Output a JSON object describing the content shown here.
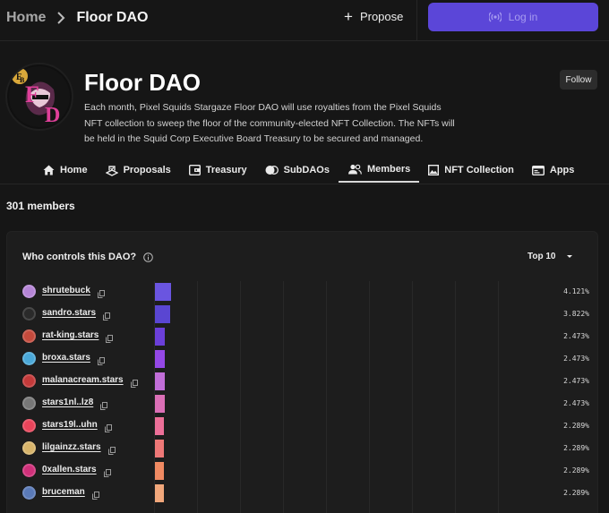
{
  "breadcrumb": {
    "home": "Home",
    "current": "Floor DAO"
  },
  "header_actions": {
    "propose": "Propose",
    "login": "Log in"
  },
  "dao": {
    "title": "Floor DAO",
    "description": "Each month, Pixel Squids Stargaze Floor DAO will use royalties from the Pixel Squids NFT collection to sweep the floor of the community-elected NFT Collection. The NFTs will be held in the Squid Corp Executive Board Treasury to be secured and managed.",
    "follow": "Follow",
    "logo_letters": {
      "a": "F",
      "b": "B",
      "c": "E",
      "d": "D"
    }
  },
  "tabs": [
    {
      "label": "Home",
      "icon": "home-icon"
    },
    {
      "label": "Proposals",
      "icon": "proposals-icon"
    },
    {
      "label": "Treasury",
      "icon": "treasury-icon"
    },
    {
      "label": "SubDAOs",
      "icon": "subdaos-icon"
    },
    {
      "label": "Members",
      "icon": "members-icon",
      "active": true
    },
    {
      "label": "NFT Collection",
      "icon": "image-icon"
    },
    {
      "label": "Apps",
      "icon": "apps-icon"
    }
  ],
  "members_count": "301 members",
  "card": {
    "title": "Who controls this DAO?",
    "filter": "Top 10"
  },
  "members": [
    {
      "name": "shrutebuck",
      "pct": "4.121%",
      "share": 4.121,
      "color": "#6a55e0",
      "avatar": "#b585d6"
    },
    {
      "name": "sandro.stars",
      "pct": "3.822%",
      "share": 3.822,
      "color": "#5a46d2",
      "avatar": "#2a2a2a"
    },
    {
      "name": "rat-king.stars",
      "pct": "2.473%",
      "share": 2.473,
      "color": "#6b3fd9",
      "avatar": "#c44a3c"
    },
    {
      "name": "broxa.stars",
      "pct": "2.473%",
      "share": 2.473,
      "color": "#9448e6",
      "avatar": "#4aa8d8"
    },
    {
      "name": "malanacream.stars",
      "pct": "2.473%",
      "share": 2.473,
      "color": "#c16ed8",
      "avatar": "#c43a3a"
    },
    {
      "name": "stars1nl..lz8",
      "pct": "2.473%",
      "share": 2.473,
      "color": "#db6fb6",
      "avatar": "#777777"
    },
    {
      "name": "stars19l..uhn",
      "pct": "2.289%",
      "share": 2.289,
      "color": "#ec6f98",
      "avatar": "#e8445a"
    },
    {
      "name": "lilgainzz.stars",
      "pct": "2.289%",
      "share": 2.289,
      "color": "#ee7877",
      "avatar": "#d8b46a"
    },
    {
      "name": "0xallen.stars",
      "pct": "2.289%",
      "share": 2.289,
      "color": "#f08a62",
      "avatar": "#d0307a"
    },
    {
      "name": "bruceman",
      "pct": "2.289%",
      "share": 2.289,
      "color": "#f1a77b",
      "avatar": "#5a7ab8"
    }
  ]
}
